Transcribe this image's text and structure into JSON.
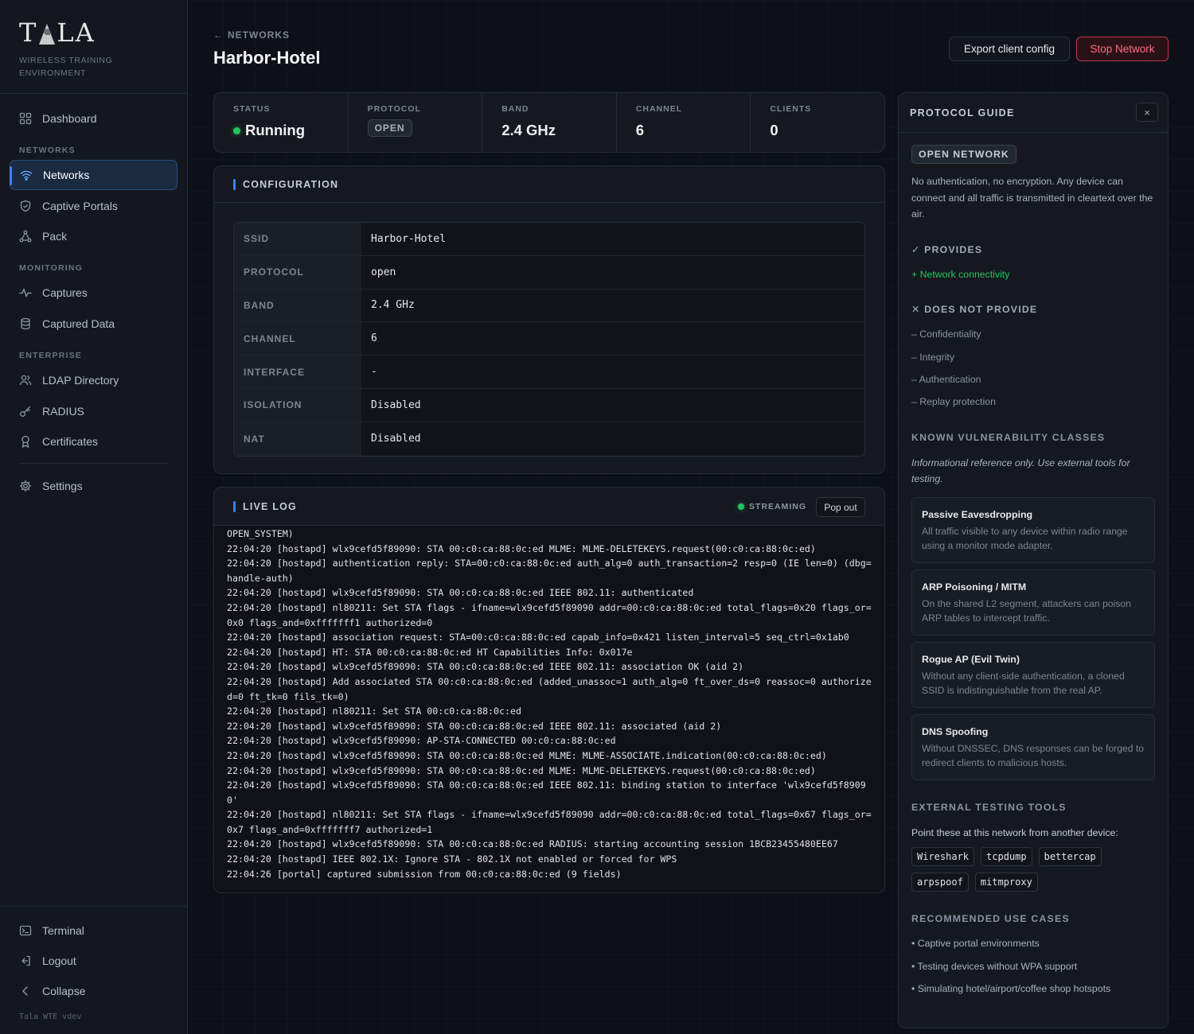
{
  "sidebar": {
    "logo": {
      "prefix": "T",
      "suffix": "LA",
      "subtitle_line1": "WIRELESS TRAINING",
      "subtitle_line2": "ENVIRONMENT"
    },
    "dashboard": "Dashboard",
    "section_networks": "NETWORKS",
    "networks": "Networks",
    "captive_portals": "Captive Portals",
    "pack": "Pack",
    "section_monitoring": "MONITORING",
    "captures": "Captures",
    "captured_data": "Captured Data",
    "section_enterprise": "ENTERPRISE",
    "ldap_directory": "LDAP Directory",
    "radius": "RADIUS",
    "certificates": "Certificates",
    "settings": "Settings",
    "terminal": "Terminal",
    "logout": "Logout",
    "collapse": "Collapse",
    "version": "Tala WTE vdev"
  },
  "header": {
    "back_label": "NETWORKS",
    "title": "Harbor-Hotel",
    "export_label": "Export client config",
    "stop_label": "Stop Network"
  },
  "stats": {
    "status_label": "STATUS",
    "status_value": "Running",
    "protocol_label": "PROTOCOL",
    "protocol_value": "OPEN",
    "band_label": "BAND",
    "band_value": "2.4 GHz",
    "channel_label": "CHANNEL",
    "channel_value": "6",
    "clients_label": "CLIENTS",
    "clients_value": "0"
  },
  "configuration": {
    "title": "CONFIGURATION",
    "rows": [
      {
        "key": "SSID",
        "value": "Harbor-Hotel"
      },
      {
        "key": "PROTOCOL",
        "value": "open"
      },
      {
        "key": "BAND",
        "value": "2.4 GHz"
      },
      {
        "key": "CHANNEL",
        "value": "6"
      },
      {
        "key": "INTERFACE",
        "value": "-"
      },
      {
        "key": "ISOLATION",
        "value": "Disabled"
      },
      {
        "key": "NAT",
        "value": "Disabled"
      }
    ]
  },
  "live_log": {
    "title": "LIVE LOG",
    "streaming_label": "STREAMING",
    "popout_label": "Pop out",
    "lines": [
      "OPEN_SYSTEM)",
      "22:04:20 [hostapd] wlx9cefd5f89090: STA 00:c0:ca:88:0c:ed MLME: MLME-DELETEKEYS.request(00:c0:ca:88:0c:ed)",
      "22:04:20 [hostapd] authentication reply: STA=00:c0:ca:88:0c:ed auth_alg=0 auth_transaction=2 resp=0 (IE len=0) (dbg=handle-auth)",
      "22:04:20 [hostapd] wlx9cefd5f89090: STA 00:c0:ca:88:0c:ed IEEE 802.11: authenticated",
      "22:04:20 [hostapd] nl80211: Set STA flags - ifname=wlx9cefd5f89090 addr=00:c0:ca:88:0c:ed total_flags=0x20 flags_or=0x0 flags_and=0xfffffff1 authorized=0",
      "22:04:20 [hostapd] association request: STA=00:c0:ca:88:0c:ed capab_info=0x421 listen_interval=5 seq_ctrl=0x1ab0",
      "22:04:20 [hostapd] HT: STA 00:c0:ca:88:0c:ed HT Capabilities Info: 0x017e",
      "22:04:20 [hostapd] wlx9cefd5f89090: STA 00:c0:ca:88:0c:ed IEEE 802.11: association OK (aid 2)",
      "22:04:20 [hostapd] Add associated STA 00:c0:ca:88:0c:ed (added_unassoc=1 auth_alg=0 ft_over_ds=0 reassoc=0 authorized=0 ft_tk=0 fils_tk=0)",
      "22:04:20 [hostapd] nl80211: Set STA 00:c0:ca:88:0c:ed",
      "22:04:20 [hostapd] wlx9cefd5f89090: STA 00:c0:ca:88:0c:ed IEEE 802.11: associated (aid 2)",
      "22:04:20 [hostapd] wlx9cefd5f89090: AP-STA-CONNECTED 00:c0:ca:88:0c:ed",
      "22:04:20 [hostapd] wlx9cefd5f89090: STA 00:c0:ca:88:0c:ed MLME: MLME-ASSOCIATE.indication(00:c0:ca:88:0c:ed)",
      "22:04:20 [hostapd] wlx9cefd5f89090: STA 00:c0:ca:88:0c:ed MLME: MLME-DELETEKEYS.request(00:c0:ca:88:0c:ed)",
      "22:04:20 [hostapd] wlx9cefd5f89090: STA 00:c0:ca:88:0c:ed IEEE 802.11: binding station to interface 'wlx9cefd5f89090'",
      "22:04:20 [hostapd] nl80211: Set STA flags - ifname=wlx9cefd5f89090 addr=00:c0:ca:88:0c:ed total_flags=0x67 flags_or=0x7 flags_and=0xfffffff7 authorized=1",
      "22:04:20 [hostapd] wlx9cefd5f89090: STA 00:c0:ca:88:0c:ed RADIUS: starting accounting session 1BCB23455480EE67",
      "22:04:20 [hostapd] IEEE 802.1X: Ignore STA - 802.1X not enabled or forced for WPS",
      "22:04:26 [portal] captured submission from 00:c0:ca:88:0c:ed (9 fields)"
    ]
  },
  "guide": {
    "title": "PROTOCOL GUIDE",
    "close_label": "×",
    "badge": "OPEN NETWORK",
    "description": "No authentication, no encryption. Any device can connect and all traffic is transmitted in cleartext over the air.",
    "provides_heading": "✓ PROVIDES",
    "provides": [
      "+ Network connectivity"
    ],
    "not_provides_heading": "✕ DOES NOT PROVIDE",
    "not_provides": [
      "– Confidentiality",
      "– Integrity",
      "– Authentication",
      "– Replay protection"
    ],
    "vuln_heading": "KNOWN VULNERABILITY CLASSES",
    "vuln_note": "Informational reference only. Use external tools for testing.",
    "vulns": [
      {
        "title": "Passive Eavesdropping",
        "desc": "All traffic visible to any device within radio range using a monitor mode adapter."
      },
      {
        "title": "ARP Poisoning / MITM",
        "desc": "On the shared L2 segment, attackers can poison ARP tables to intercept traffic."
      },
      {
        "title": "Rogue AP (Evil Twin)",
        "desc": "Without any client-side authentication, a cloned SSID is indistinguishable from the real AP."
      },
      {
        "title": "DNS Spoofing",
        "desc": "Without DNSSEC, DNS responses can be forged to redirect clients to malicious hosts."
      }
    ],
    "tools_heading": "EXTERNAL TESTING TOOLS",
    "tools_note": "Point these at this network from another device:",
    "tools": [
      "Wireshark",
      "tcpdump",
      "bettercap",
      "arpspoof",
      "mitmproxy"
    ],
    "use_heading": "RECOMMENDED USE CASES",
    "use_cases": [
      "• Captive portal environments",
      "• Testing devices without WPA support",
      "• Simulating hotel/airport/coffee shop hotspots"
    ]
  }
}
